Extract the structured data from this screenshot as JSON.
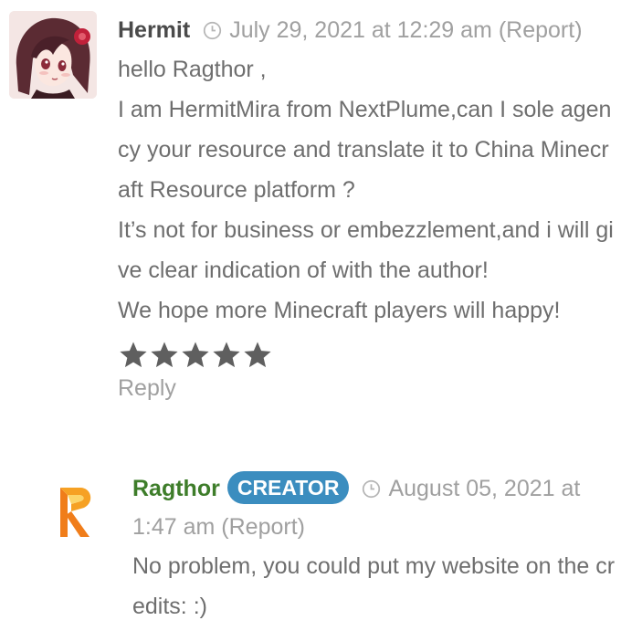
{
  "comments": [
    {
      "author": "Hermit",
      "date": "July 29, 2021 at 12:29 am",
      "report": "(Report)",
      "lines": [
        "hello Ragthor ,",
        "I am HermitMira from NextPlume,can I sole agency your resource and translate it to China Minecraft Resource platform ?",
        "It’s not for business or embezzlement,and i will give clear indication of with the author!",
        "We hope more Minecraft players will happy!"
      ],
      "rating": 5,
      "reply_label": "Reply"
    },
    {
      "author": "Ragthor",
      "badge": "CREATOR",
      "date": "August 05, 2021 at 1:47 am",
      "report": "(Report)",
      "lines": [
        "No problem, you could put my website on the credits: :)"
      ]
    }
  ],
  "colors": {
    "author_hermit": "#4a4a4a",
    "author_ragthor": "#3e7d2a",
    "badge_bg": "#3b8dbf",
    "muted_text": "#a0a0a0",
    "body_text": "#6e6e6e",
    "star": "#5f5f5f",
    "logo_orange": "#f39a1e"
  },
  "icons": {
    "clock": "clock-icon",
    "star": "star-icon",
    "ragthor_logo": "ragthor-logo-icon"
  }
}
